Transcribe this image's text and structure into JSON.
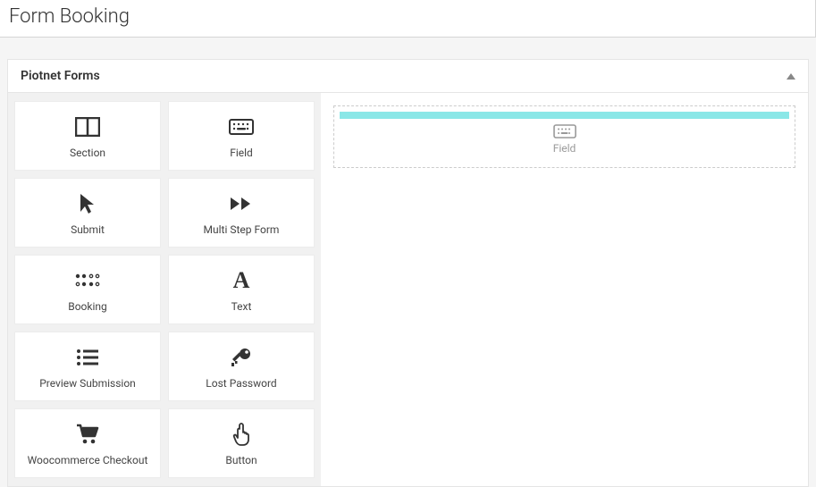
{
  "title": "Form Booking",
  "panel": {
    "header": "Piotnet Forms"
  },
  "widgets": [
    {
      "icon": "section",
      "label": "Section"
    },
    {
      "icon": "field",
      "label": "Field"
    },
    {
      "icon": "submit",
      "label": "Submit"
    },
    {
      "icon": "multistep",
      "label": "Multi Step Form"
    },
    {
      "icon": "booking",
      "label": "Booking"
    },
    {
      "icon": "text",
      "label": "Text"
    },
    {
      "icon": "preview",
      "label": "Preview Submission"
    },
    {
      "icon": "password",
      "label": "Lost Password"
    },
    {
      "icon": "cart",
      "label": "Woocommerce Checkout"
    },
    {
      "icon": "button",
      "label": "Button"
    }
  ],
  "canvas": {
    "placeholder_label": "Field"
  }
}
